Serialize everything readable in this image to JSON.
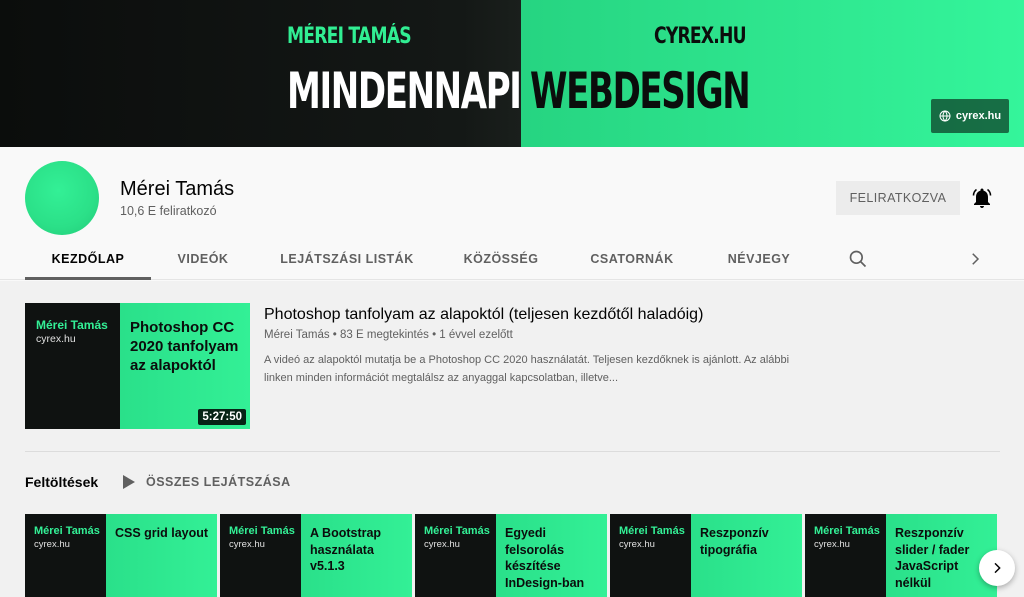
{
  "banner": {
    "name": "MÉREI TAMÁS",
    "site": "CYREX.HU",
    "headline_left": "MINDENNAPI",
    "headline_right": "WEBDESIGN",
    "link_label": "cyrex.hu",
    "link_icon": "globe-icon"
  },
  "channel": {
    "name": "Mérei Tamás",
    "subscribers": "10,6 E feliratkozó",
    "subscribe_label": "FELIRATKOZVA",
    "bell_icon": "bell-icon"
  },
  "tabs": [
    {
      "label": "KEZDŐLAP"
    },
    {
      "label": "VIDEÓK"
    },
    {
      "label": "LEJÁTSZÁSI LISTÁK"
    },
    {
      "label": "KÖZÖSSÉG"
    },
    {
      "label": "CSATORNÁK"
    },
    {
      "label": "NÉVJEGY"
    }
  ],
  "featured": {
    "thumb_brand": "Mérei Tamás",
    "thumb_brand_sub": "cyrex.hu",
    "thumb_title": "Photoshop CC 2020 tanfolyam az alapoktól",
    "duration": "5:27:50",
    "title": "Photoshop tanfolyam az alapoktól (teljesen kezdőtől haladóig)",
    "meta": "Mérei Tamás • 83 E megtekintés • 1 évvel ezelőtt",
    "description": "A videó az alapoktól mutatja be a Photoshop CC 2020 használatát. Teljesen kezdőknek is ajánlott. Az alábbi linken minden információt megtalálsz az anyaggal kapcsolatban, illetve..."
  },
  "shelf": {
    "title": "Feltöltések",
    "play_all": "ÖSSZES LEJÁTSZÁSA",
    "items": [
      {
        "brand": "Mérei Tamás",
        "brand_sub": "cyrex.hu",
        "title": "CSS grid layout"
      },
      {
        "brand": "Mérei Tamás",
        "brand_sub": "cyrex.hu",
        "title": "A Bootstrap használata v5.1.3"
      },
      {
        "brand": "Mérei Tamás",
        "brand_sub": "cyrex.hu",
        "title": "Egyedi felsorolás készítése InDesign-ban"
      },
      {
        "brand": "Mérei Tamás",
        "brand_sub": "cyrex.hu",
        "title": "Reszponzív tipográfia"
      },
      {
        "brand": "Mérei Tamás",
        "brand_sub": "cyrex.hu",
        "title": "Reszponzív slider / fader JavaScript nélkül"
      }
    ]
  },
  "colors": {
    "accent_green": "#33f096",
    "dark": "#0b0d0c"
  }
}
